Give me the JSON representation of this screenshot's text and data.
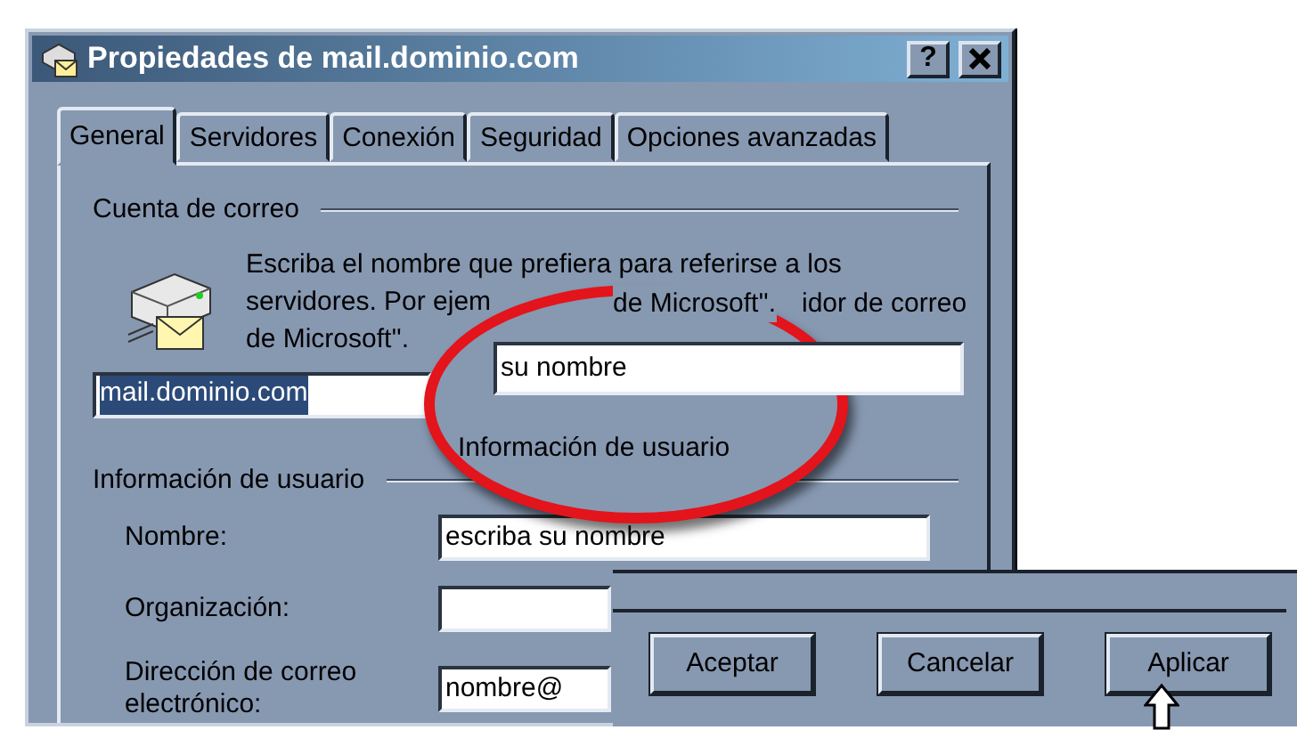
{
  "window": {
    "title": "Propiedades de mail.dominio.com",
    "help_button": "?"
  },
  "tabs": [
    {
      "label": "General",
      "selected": true
    },
    {
      "label": "Servidores",
      "selected": false
    },
    {
      "label": "Conexión",
      "selected": false
    },
    {
      "label": "Seguridad",
      "selected": false
    },
    {
      "label": "Opciones avanzadas",
      "selected": false
    }
  ],
  "mail_account": {
    "heading": "Cuenta de correo",
    "description_lines": [
      "Escriba el nombre que prefiera para referirse a los",
      "servidores. Por ejem",
      "de Microsoft''."
    ],
    "account_name": {
      "value": "mail.dominio.com",
      "selected": true
    }
  },
  "user_info": {
    "heading": "Información de usuario",
    "fields": [
      {
        "label": "Nombre:",
        "value": "escriba su nombre"
      },
      {
        "label": "Organización:"
      },
      {
        "label": "Dirección de correo electrónico:",
        "value": "nombre@"
      }
    ]
  },
  "callout": {
    "background_text": [
      "de Microsoft''.",
      "idor de correo"
    ],
    "value": "su nombre",
    "label": "Información de usuario"
  },
  "button_bar": {
    "buttons": [
      "Aceptar",
      "Cancelar",
      "Aplicar"
    ]
  }
}
